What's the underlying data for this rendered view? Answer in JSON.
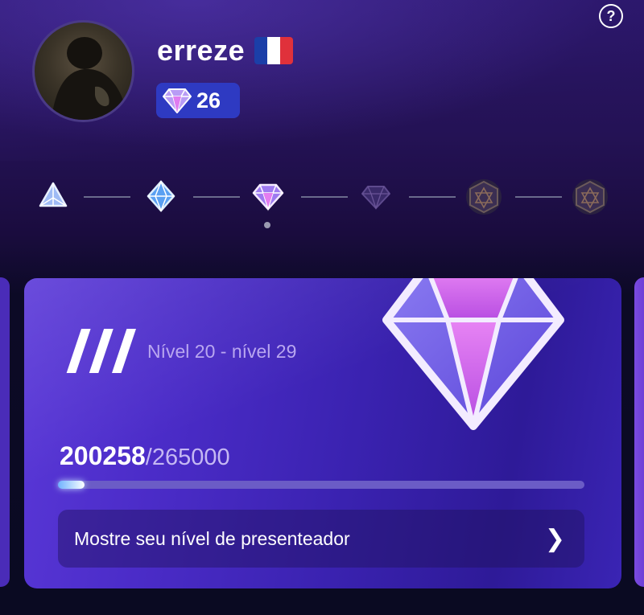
{
  "profile": {
    "username": "erreze",
    "flag": {
      "country": "France",
      "colors": [
        "#1b3fa8",
        "#ffffff",
        "#e0313b"
      ]
    },
    "badge_count": "26",
    "help_label": "?"
  },
  "levels": {
    "current_index": 2,
    "icons": [
      "triangle-gem-icon",
      "octahedron-gem-icon",
      "diamond-gem-icon",
      "dark-diamond-icon",
      "hexagon-emblem-icon",
      "hexagon-emblem-icon"
    ]
  },
  "card": {
    "tier_numeral": "III",
    "level_range": "Nível 20 - nível 29",
    "progress_current": "200258",
    "progress_total": "/265000",
    "progress_fraction": 0.05,
    "cta_label": "Mostre seu nível de presenteador"
  },
  "colors": {
    "badge_bg": "#2e3ac2",
    "card_accent": "#4b2cc8",
    "diamond_pink": "#d77cf2"
  }
}
